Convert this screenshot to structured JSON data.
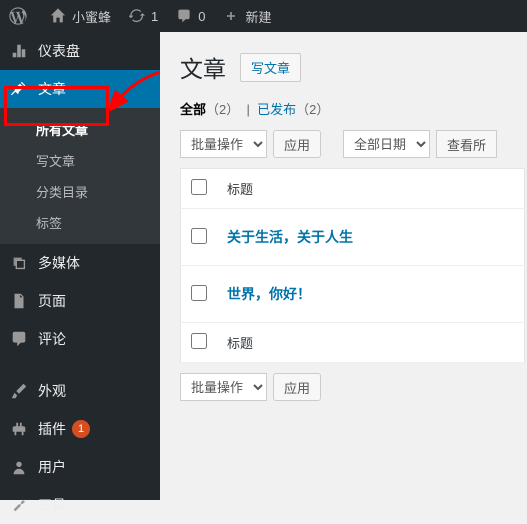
{
  "adminbar": {
    "site_name": "小蜜蜂",
    "updates": "1",
    "comments": "0",
    "new": "新建"
  },
  "sidebar": {
    "dashboard": "仪表盘",
    "posts": "文章",
    "submenu": {
      "all": "所有文章",
      "new": "写文章",
      "categories": "分类目录",
      "tags": "标签"
    },
    "media": "多媒体",
    "pages": "页面",
    "comments": "评论",
    "appearance": "外观",
    "plugins": "插件",
    "plugins_badge": "1",
    "users": "用户",
    "tools": "工具"
  },
  "content": {
    "title": "文章",
    "add_new": "写文章",
    "filters": {
      "all_label": "全部",
      "all_count": "（2）",
      "published_label": "已发布",
      "published_count": "（2）"
    },
    "bulk_action": "批量操作",
    "apply": "应用",
    "all_dates": "全部日期",
    "view_all": "查看所",
    "col_title": "标题",
    "posts": [
      {
        "title": "关于生活，关于人生"
      },
      {
        "title": "世界，你好！"
      }
    ]
  }
}
